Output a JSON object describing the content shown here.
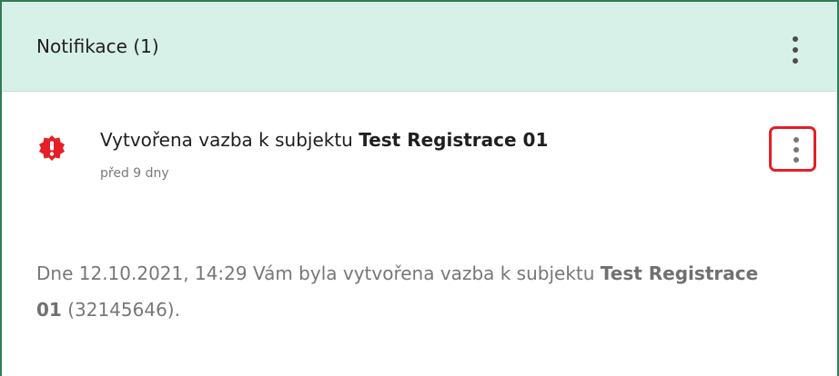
{
  "panel": {
    "title": "Notifikace (1)"
  },
  "notification": {
    "icon": "alert-octagon-icon",
    "title_prefix": "Vytvořena vazba k subjektu ",
    "title_subject": "Test Registrace 01",
    "time_ago": "před 9 dny",
    "body_prefix": "Dne 12.10.2021, 14:29 Vám byla vytvořena vazba k subjektu ",
    "body_subject": "Test Registrace 01",
    "body_suffix": " (32145646)."
  },
  "colors": {
    "header_bg": "#d7f0e8",
    "border": "#2e7d55",
    "alert_red": "#e41f26",
    "highlight_red": "#e41f26"
  }
}
